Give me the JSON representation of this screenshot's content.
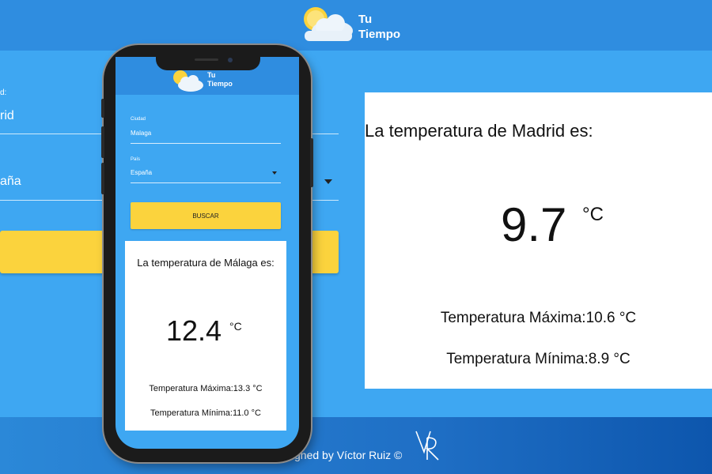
{
  "header": {
    "logo_line1": "Tu",
    "logo_line2": "Tiempo"
  },
  "desktop_form": {
    "city_label": "d:",
    "city_value": "rid",
    "country_value": "aña"
  },
  "result": {
    "title": "La temperatura de Madrid es:",
    "temperature": "9.7",
    "unit": "°C",
    "max": "Temperatura Máxima:10.6 °C",
    "min": "Temperatura Mínima:8.9 °C"
  },
  "footer": {
    "credit": "gned by Víctor Ruiz ©"
  },
  "phone": {
    "logo_line1": "Tu",
    "logo_line2": "Tiempo",
    "city_label": "Ciudad",
    "city_value": "Malaga",
    "country_label": "País",
    "country_value": "España",
    "button_label": "BUSCAR",
    "result_title": "La temperatura de Málaga es:",
    "temperature": "12.4",
    "unit": "°C",
    "max": "Temperatura Máxima:13.3 °C",
    "min": "Temperatura Mínima:11.0 °C"
  },
  "icons": {
    "logo": "sun-cloud-icon",
    "dropdown": "caret-down-icon",
    "signature": "vr-signature-icon"
  },
  "colors": {
    "topbar": "#2f8de0",
    "background": "#3ea7f2",
    "button": "#fbd33d",
    "card": "#ffffff"
  }
}
